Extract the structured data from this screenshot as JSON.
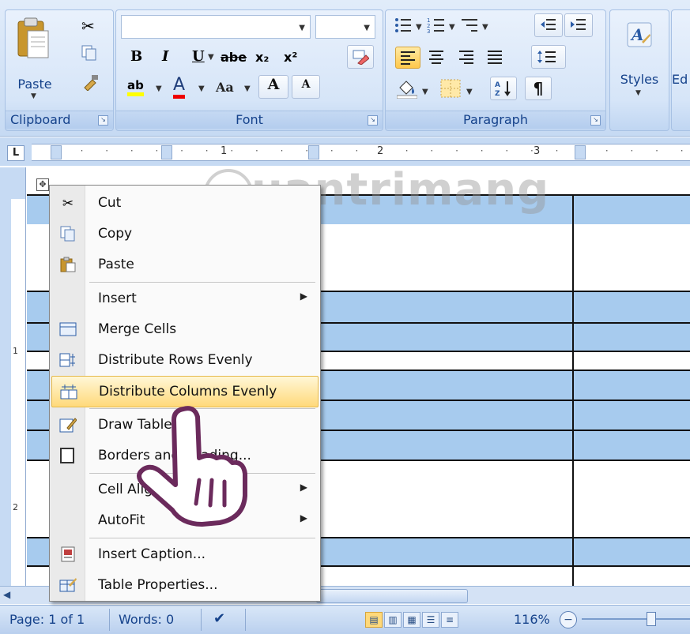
{
  "ribbon": {
    "clipboard": {
      "label": "Clipboard",
      "paste_label": "Paste"
    },
    "font": {
      "label": "Font",
      "bold": "B",
      "italic": "I",
      "underline": "U",
      "strike": "abe",
      "subscript": "x₂",
      "superscript": "x²",
      "highlight": "ab",
      "font_color": "A",
      "change_case": "Aa",
      "grow": "A",
      "shrink": "A"
    },
    "paragraph": {
      "label": "Paragraph",
      "pilcrow": "¶"
    },
    "styles": {
      "label": "Styles"
    },
    "editing": {
      "label": "Ed"
    }
  },
  "ruler": {
    "tab_selector": "L",
    "marks": [
      "1",
      "2",
      "3"
    ]
  },
  "watermark": {
    "text": "uantrimang"
  },
  "context_menu": {
    "items": [
      {
        "label": "Cut",
        "icon": "scissors-icon"
      },
      {
        "label": "Copy",
        "icon": "copy-icon"
      },
      {
        "label": "Paste",
        "icon": "paste-icon"
      },
      {
        "label": "Insert",
        "icon": "",
        "submenu": true
      },
      {
        "label": "Merge Cells",
        "icon": "merge-cells-icon"
      },
      {
        "label": "Distribute Rows Evenly",
        "icon": "distribute-rows-icon"
      },
      {
        "label": "Distribute Columns Evenly",
        "icon": "distribute-columns-icon",
        "highlighted": true
      },
      {
        "label": "Draw Table",
        "icon": "draw-table-icon"
      },
      {
        "label": "Borders and Shading...",
        "icon": "borders-icon"
      },
      {
        "label": "Cell Alignment",
        "icon": "",
        "submenu": true
      },
      {
        "label": "AutoFit",
        "icon": "",
        "submenu": true
      },
      {
        "label": "Insert Caption...",
        "icon": "caption-icon"
      },
      {
        "label": "Table Properties...",
        "icon": "table-properties-icon"
      }
    ]
  },
  "status_bar": {
    "page": "Page: 1 of 1",
    "words": "Words: 0",
    "zoom": "116%"
  },
  "colors": {
    "row_band": "#a7cbee",
    "menu_highlight": "#ffd97a"
  }
}
